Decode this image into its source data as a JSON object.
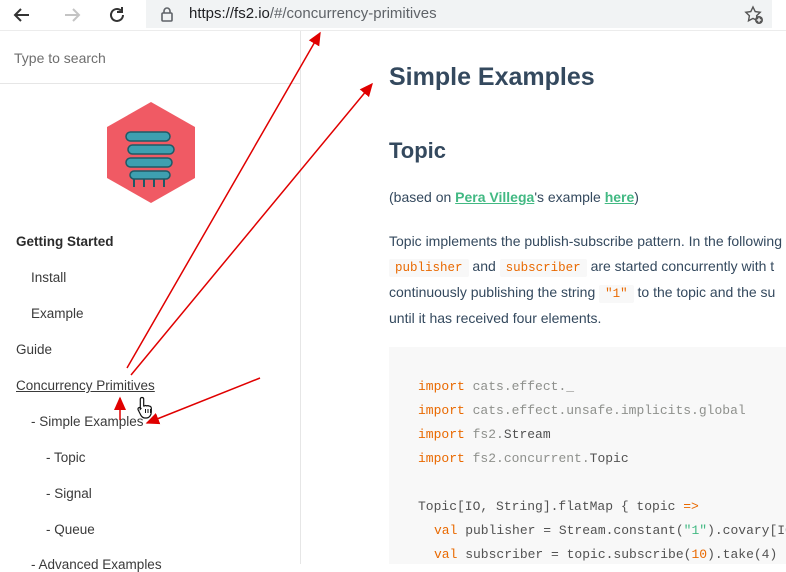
{
  "browser": {
    "url_host": "https://fs2.io",
    "url_path": "/#/concurrency-primitives"
  },
  "sidebar": {
    "search_placeholder": "Type to search",
    "items": [
      {
        "label": "Getting Started",
        "style": "bold"
      },
      {
        "label": "Install"
      },
      {
        "label": "Example"
      },
      {
        "label": "Guide"
      },
      {
        "label": "Concurrency Primitives",
        "style": "link"
      },
      {
        "label": "- Simple Examples"
      },
      {
        "label": "- Topic"
      },
      {
        "label": "- Signal"
      },
      {
        "label": "- Queue"
      },
      {
        "label": "- Advanced Examples"
      }
    ]
  },
  "content": {
    "title": "Simple Examples",
    "section": "Topic",
    "based_prefix": "(based on ",
    "based_author": "Pera Villega",
    "based_mid": "'s example ",
    "based_link": "here",
    "based_suffix": ")",
    "p1_line1": "Topic implements the publish-subscribe pattern. In the following",
    "p1_code1": "publisher",
    "p1_and": "and",
    "p1_code2": "subscriber",
    "p1_line2_rest": "are started concurrently with t",
    "p1_line3_pre": "continuously publishing the string",
    "p1_code3": "\"1\"",
    "p1_line3_post": "to the topic and the su",
    "p1_line4": "until it has received four elements."
  },
  "code": {
    "l1_kw": "import",
    "l1": "cats.effect._",
    "l2_kw": "import",
    "l2": "cats.effect.unsafe.implicits.global",
    "l3_kw": "import",
    "l3a": "fs2.",
    "l3b": "Stream",
    "l4_kw": "import",
    "l4a": "fs2.concurrent.",
    "l4b": "Topic",
    "l5a": "Topic[IO, String].flatMap { topic ",
    "l5_op": "=>",
    "l6_kw": "val",
    "l6a": " publisher = Stream.constant(",
    "l6_str": "\"1\"",
    "l6b": ").covary[IO",
    "l7_kw": "val",
    "l7a": " subscriber = topic.subscribe(",
    "l7_num": "10",
    "l7b": ").take(4)"
  },
  "colors": {
    "accent": "#42b983",
    "heading": "#34495e",
    "code_keyword": "#e96900",
    "annotation": "#e00000",
    "logo_hex": "#f05a64"
  }
}
